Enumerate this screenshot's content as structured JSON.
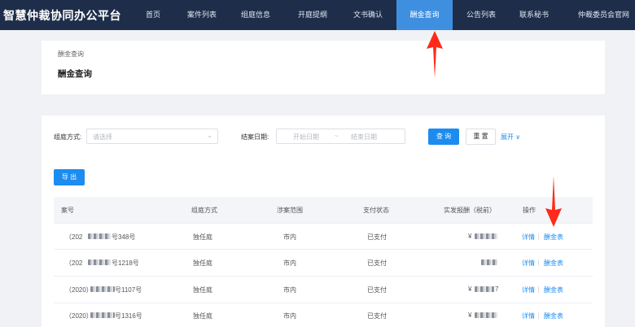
{
  "app": {
    "title": "智慧仲裁协同办公平台"
  },
  "nav": {
    "items": [
      {
        "label": "首页"
      },
      {
        "label": "案件列表"
      },
      {
        "label": "组庭信息"
      },
      {
        "label": "开庭提纲"
      },
      {
        "label": "文书确认"
      },
      {
        "label": "酬金查询",
        "active": true
      },
      {
        "label": "公告列表"
      },
      {
        "label": "联系秘书"
      },
      {
        "label": "仲裁委员会官网"
      }
    ]
  },
  "page": {
    "breadcrumb": "酬金查询",
    "title": "酬金查询"
  },
  "filters": {
    "court_mode_label": "组庭方式:",
    "court_mode_placeholder": "请选择",
    "close_date_label": "结案日期:",
    "start_placeholder": "开始日期",
    "range_sep": "~",
    "end_placeholder": "结束日期",
    "search_label": "查 询",
    "reset_label": "重 置",
    "expand_label": "展开"
  },
  "export_label": "导 出",
  "table": {
    "headers": [
      "案号",
      "组庭方式",
      "涉案范围",
      "支付状态",
      "实发报酬（税前）",
      "操作"
    ],
    "rows": [
      {
        "case_prefix": "（202",
        "case_suffix": "号348号",
        "mode": "独任庭",
        "scope": "市内",
        "status": "已支付",
        "pay_prefix": "¥",
        "pay_suffix": "",
        "detail": "详情",
        "fee": "酬金表"
      },
      {
        "case_prefix": "（202",
        "case_suffix": "号1218号",
        "mode": "独任庭",
        "scope": "市内",
        "status": "已支付",
        "pay_prefix": "",
        "pay_suffix": "",
        "detail": "详情",
        "fee": "酬金表"
      },
      {
        "case_prefix": "（2020）",
        "case_suffix": "号1107号",
        "mode": "独任庭",
        "scope": "市内",
        "status": "已支付",
        "pay_prefix": "¥",
        "pay_suffix": "7",
        "detail": "详情",
        "fee": "酬金表"
      },
      {
        "case_prefix": "（2020）",
        "case_suffix": "号1316号",
        "mode": "独任庭",
        "scope": "市内",
        "status": "已支付",
        "pay_prefix": "¥",
        "pay_suffix": "",
        "detail": "详情",
        "fee": "酬金表"
      }
    ]
  },
  "colors": {
    "nav_bg": "#1e2e4a",
    "nav_active": "#3f8fe0",
    "primary": "#1c8cf0",
    "annotation": "#ff2a1a"
  },
  "icons": {
    "expand": "chevron-down-icon",
    "select": "chevron-down-icon"
  }
}
